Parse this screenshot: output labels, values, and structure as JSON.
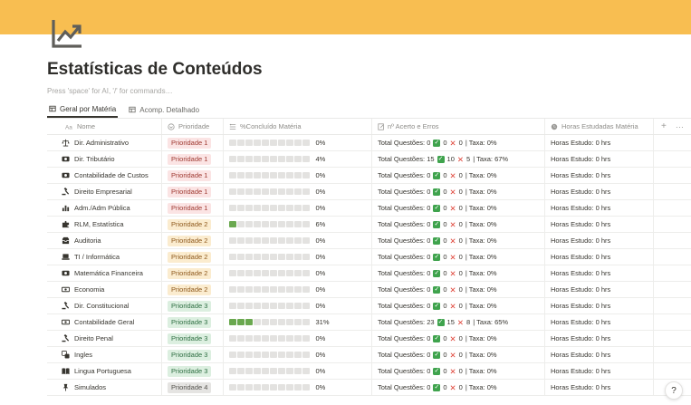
{
  "page": {
    "icon": "trending-up-icon",
    "title": "Estatísticas de Conteúdos",
    "placeholder": "Press 'space' for AI, '/' for commands…"
  },
  "colors": {
    "cover": "#f8be51",
    "progress_on": "#6aa84f",
    "progress_off": "#e3e2e0",
    "check": "#3fa34d",
    "cross": "#e0473b"
  },
  "tabs": [
    {
      "label": "Geral por Matéria",
      "icon": "table-icon",
      "active": true
    },
    {
      "label": "Acomp. Detalhado",
      "icon": "table-icon",
      "active": false
    }
  ],
  "columns": {
    "name": "Nome",
    "priority": "Prioridade",
    "progress": "%Concluído Matéria",
    "accuracy": "nº Acerto e Erros",
    "hours": "Horas Estudadas Matéria",
    "add": "+",
    "more": "···"
  },
  "priorities": {
    "Prioridade 1": {
      "bg": "#fbe4e4",
      "fg": "#9f3a32"
    },
    "Prioridade 2": {
      "bg": "#fbeccf",
      "fg": "#8f5a1e"
    },
    "Prioridade 3": {
      "bg": "#dcefe0",
      "fg": "#2f6f43"
    },
    "Prioridade 4": {
      "bg": "#e5e4e2",
      "fg": "#55534e"
    }
  },
  "rows": [
    {
      "name": "Dir. Administrativo",
      "icon": "scales-icon",
      "priority": "Prioridade 1",
      "progress": 0,
      "progress_label": "0%",
      "questions": "Total Questões: 0",
      "hits": "0",
      "errors": "0",
      "rate": "| Taxa: 0%",
      "hours": "Horas Estudo: 0 hrs"
    },
    {
      "name": "Dir. Tributário",
      "icon": "money-icon",
      "priority": "Prioridade 1",
      "progress": 4,
      "progress_label": "4%",
      "questions": "Total Questões: 15",
      "hits": "10",
      "errors": "5",
      "rate": "| Taxa: 67%",
      "hours": "Horas Estudo: 0 hrs"
    },
    {
      "name": "Contabilidade de Custos",
      "icon": "money-icon",
      "priority": "Prioridade 1",
      "progress": 0,
      "progress_label": "0%",
      "questions": "Total Questões: 0",
      "hits": "0",
      "errors": "0",
      "rate": "| Taxa: 0%",
      "hours": "Horas Estudo: 0 hrs"
    },
    {
      "name": "Direito Empresarial",
      "icon": "gavel-icon",
      "priority": "Prioridade 1",
      "progress": 0,
      "progress_label": "0%",
      "questions": "Total Questões: 0",
      "hits": "0",
      "errors": "0",
      "rate": "| Taxa: 0%",
      "hours": "Horas Estudo: 0 hrs"
    },
    {
      "name": "Adm./Adm Pública",
      "icon": "bar-chart-icon",
      "priority": "Prioridade 1",
      "progress": 0,
      "progress_label": "0%",
      "questions": "Total Questões: 0",
      "hits": "0",
      "errors": "0",
      "rate": "| Taxa: 0%",
      "hours": "Horas Estudo: 0 hrs"
    },
    {
      "name": "RLM, Estatística",
      "icon": "puzzle-icon",
      "priority": "Prioridade 2",
      "progress": 6,
      "progress_label": "6%",
      "questions": "Total Questões: 0",
      "hits": "0",
      "errors": "0",
      "rate": "| Taxa: 0%",
      "hours": "Horas Estudo: 0 hrs"
    },
    {
      "name": "Auditoria",
      "icon": "inbox-icon",
      "priority": "Prioridade 2",
      "progress": 0,
      "progress_label": "0%",
      "questions": "Total Questões: 0",
      "hits": "0",
      "errors": "0",
      "rate": "| Taxa: 0%",
      "hours": "Horas Estudo: 0 hrs"
    },
    {
      "name": "TI / Informática",
      "icon": "laptop-icon",
      "priority": "Prioridade 2",
      "progress": 0,
      "progress_label": "0%",
      "questions": "Total Questões: 0",
      "hits": "0",
      "errors": "0",
      "rate": "| Taxa: 0%",
      "hours": "Horas Estudo: 0 hrs"
    },
    {
      "name": "Matemática Financeira",
      "icon": "money-icon",
      "priority": "Prioridade 2",
      "progress": 0,
      "progress_label": "0%",
      "questions": "Total Questões: 0",
      "hits": "0",
      "errors": "0",
      "rate": "| Taxa: 0%",
      "hours": "Horas Estudo: 0 hrs"
    },
    {
      "name": "Economia",
      "icon": "banknote-icon",
      "priority": "Prioridade 2",
      "progress": 0,
      "progress_label": "0%",
      "questions": "Total Questões: 0",
      "hits": "0",
      "errors": "0",
      "rate": "| Taxa: 0%",
      "hours": "Horas Estudo: 0 hrs"
    },
    {
      "name": "Dir. Constitucional",
      "icon": "gavel-icon",
      "priority": "Prioridade 3",
      "progress": 0,
      "progress_label": "0%",
      "questions": "Total Questões: 0",
      "hits": "0",
      "errors": "0",
      "rate": "| Taxa: 0%",
      "hours": "Horas Estudo: 0 hrs"
    },
    {
      "name": "Contabilidade Geral",
      "icon": "banknote-icon",
      "priority": "Prioridade 3",
      "progress": 31,
      "progress_label": "31%",
      "questions": "Total Questões: 23",
      "hits": "15",
      "errors": "8",
      "rate": "| Taxa: 65%",
      "hours": "Horas Estudo: 0 hrs"
    },
    {
      "name": "Direito Penal",
      "icon": "gavel-icon",
      "priority": "Prioridade 3",
      "progress": 0,
      "progress_label": "0%",
      "questions": "Total Questões: 0",
      "hits": "0",
      "errors": "0",
      "rate": "| Taxa: 0%",
      "hours": "Horas Estudo: 0 hrs"
    },
    {
      "name": "Ingles",
      "icon": "translate-icon",
      "priority": "Prioridade 3",
      "progress": 0,
      "progress_label": "0%",
      "questions": "Total Questões: 0",
      "hits": "0",
      "errors": "0",
      "rate": "| Taxa: 0%",
      "hours": "Horas Estudo: 0 hrs"
    },
    {
      "name": "Lingua Portuguesa",
      "icon": "book-icon",
      "priority": "Prioridade 3",
      "progress": 0,
      "progress_label": "0%",
      "questions": "Total Questões: 0",
      "hits": "0",
      "errors": "0",
      "rate": "| Taxa: 0%",
      "hours": "Horas Estudo: 0 hrs"
    },
    {
      "name": "Simulados",
      "icon": "pin-icon",
      "priority": "Prioridade 4",
      "progress": 0,
      "progress_label": "0%",
      "questions": "Total Questões: 0",
      "hits": "0",
      "errors": "0",
      "rate": "| Taxa: 0%",
      "hours": "Horas Estudo: 0 hrs"
    }
  ],
  "help_label": "?"
}
